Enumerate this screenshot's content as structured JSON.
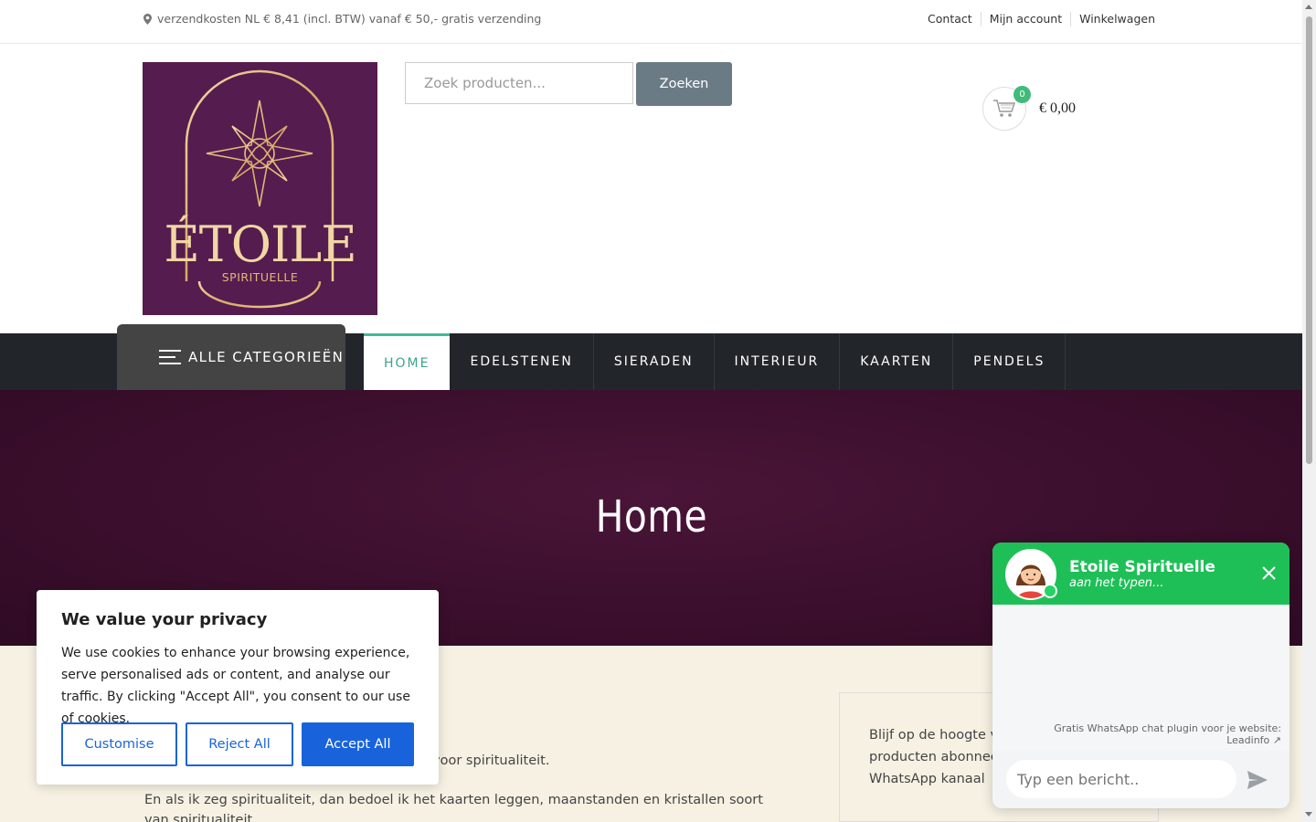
{
  "topbar": {
    "shipping_text": "verzendkosten NL € 8,41 (incl. BTW) vanaf € 50,- gratis verzending",
    "links": [
      "Contact",
      "Mijn account",
      "Winkelwagen"
    ]
  },
  "header": {
    "logo_text": "ÉTOILE",
    "logo_subtext": "SPIRITUELLE",
    "search_placeholder": "Zoek producten...",
    "search_button": "Zoeken",
    "cart_count": "0",
    "cart_total": "€ 0,00"
  },
  "nav": {
    "all_categories": "ALLE CATEGORIEËN",
    "items": [
      "HOME",
      "EDELSTENEN",
      "SIERADEN",
      "INTERIEUR",
      "KAARTEN",
      "PENDELS"
    ]
  },
  "hero": {
    "title": "Home"
  },
  "content": {
    "para1": "abrina en ik draag al jaren een passie mee voor spiritualiteit.",
    "para2": "En als ik zeg spiritualiteit, dan bedoel ik het kaarten leggen, maanstanden en kristallen soort van spiritualiteit.",
    "sidebox_text": "Blijf op de hoogte van de nieuwste producten abonneer nu op ons WhatsApp kanaal"
  },
  "cookie": {
    "title": "We value your privacy",
    "text": "We use cookies to enhance your browsing experience, serve personalised ads or content, and analyse our traffic. By clicking \"Accept All\", you consent to our use of cookies.",
    "customise": "Customise",
    "reject": "Reject All",
    "accept": "Accept All"
  },
  "whatsapp": {
    "name": "Etoile Spirituelle",
    "status": "aan het typen...",
    "credit_line1": "Gratis WhatsApp chat plugin voor je website:",
    "credit_line2": "Leadinfo ↗",
    "input_placeholder": "Typ een bericht.."
  },
  "colors": {
    "brand_purple": "#551c4f",
    "nav_dark": "#22262a",
    "active_green": "#3fa38e",
    "whatsapp_green": "#1fbf57",
    "cookie_blue": "#1863dc"
  }
}
